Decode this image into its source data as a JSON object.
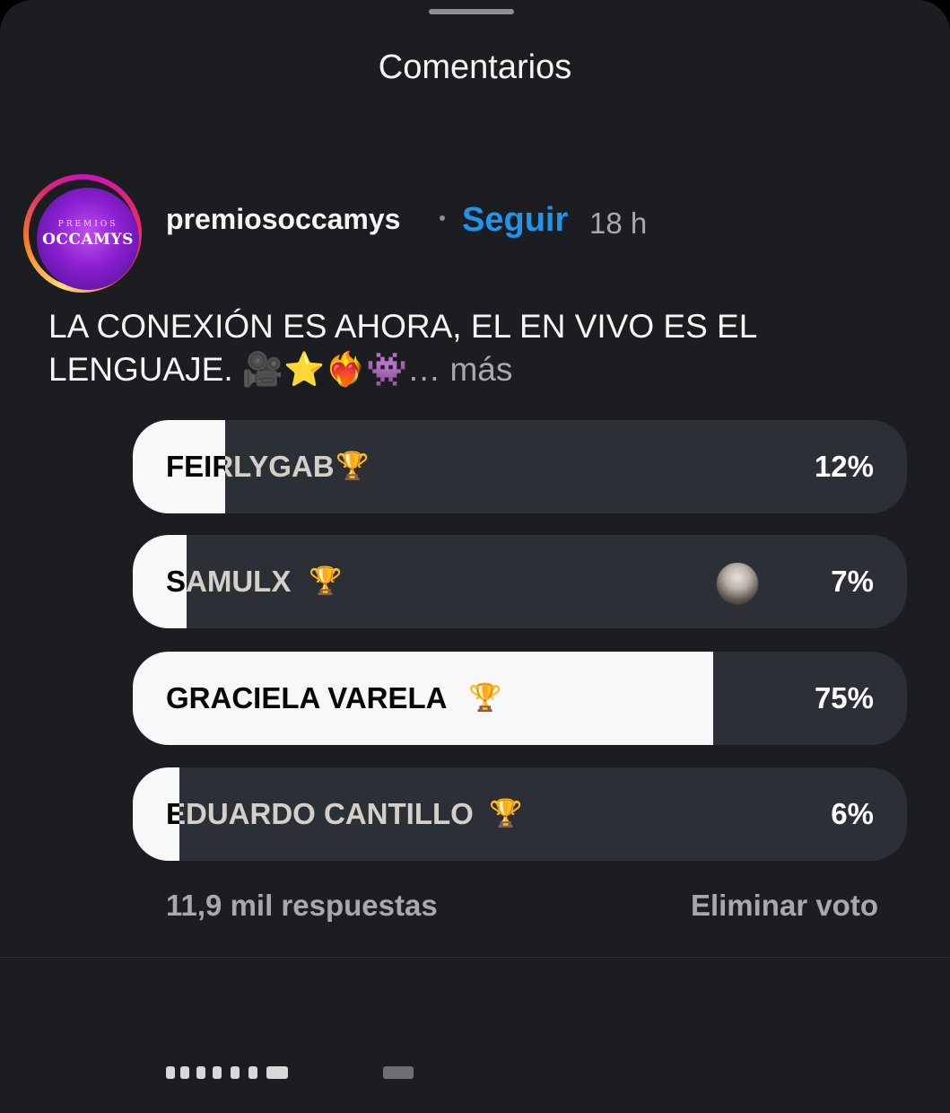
{
  "sheet": {
    "title": "Comentarios"
  },
  "post": {
    "avatar_text_small": "PREMIOS",
    "avatar_text_large": "OCCAMYS",
    "username": "premiosoccamys",
    "follow_label": "Seguir",
    "time": "18 h",
    "caption": "LA CONEXIÓN ES AHORA, EL EN VIVO ES EL LENGUAJE. 🎥⭐❤️‍🔥👾",
    "more_label": "… más"
  },
  "poll": {
    "options": [
      {
        "label": "FEIRLYGAB",
        "icon": "trophy-icon",
        "icon_glyph": "🏆",
        "percent": "12%",
        "fill": 0.12
      },
      {
        "label": "SAMULX",
        "icon": "trophy-icon",
        "icon_glyph": "🏆",
        "percent": "7%",
        "fill": 0.07,
        "voted": true
      },
      {
        "label": "GRACIELA VARELA",
        "icon": "trophy-icon",
        "icon_glyph": "🏆",
        "percent": "75%",
        "fill": 0.75
      },
      {
        "label": "EDUARDO CANTILLO",
        "icon": "trophy-icon",
        "icon_glyph": "🏆",
        "percent": "6%",
        "fill": 0.06
      }
    ],
    "responses": "11,9 mil respuestas",
    "remove_vote": "Eliminar voto"
  },
  "colors": {
    "background": "#1c1d21",
    "option_bg": "#2c2f36",
    "option_fill": "#f8f8f8",
    "follow": "#1e96f0",
    "muted": "#a8a9ad"
  }
}
